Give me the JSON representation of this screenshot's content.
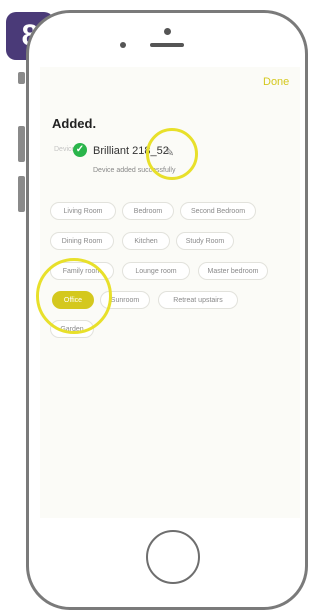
{
  "step": "8",
  "header": {
    "done_label": "Done"
  },
  "added_title": "Added.",
  "device": {
    "image_caption": "Device",
    "name": "Brilliant 218_52",
    "status": "Device added successfully"
  },
  "rooms": [
    {
      "label": "Living Room",
      "selected": false
    },
    {
      "label": "Bedroom",
      "selected": false
    },
    {
      "label": "Second Bedroom",
      "selected": false
    },
    {
      "label": "Dining Room",
      "selected": false
    },
    {
      "label": "Kitchen",
      "selected": false
    },
    {
      "label": "Study Room",
      "selected": false
    },
    {
      "label": "Family room",
      "selected": false
    },
    {
      "label": "Lounge room",
      "selected": false
    },
    {
      "label": "Master bedroom",
      "selected": false
    },
    {
      "label": "Office",
      "selected": true
    },
    {
      "label": "Sunroom",
      "selected": false
    },
    {
      "label": "Retreat upstairs",
      "selected": false
    },
    {
      "label": "Garden",
      "selected": false
    }
  ],
  "colors": {
    "accent": "#d4c81e",
    "badge": "#4a3a78",
    "check": "#2ab54b"
  }
}
